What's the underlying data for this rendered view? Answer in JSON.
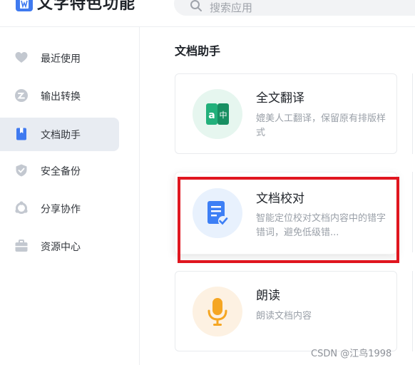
{
  "header": {
    "app_title": "文字特色功能",
    "search_placeholder": "搜索应用"
  },
  "sidebar": {
    "items": [
      {
        "label": "最近使用",
        "icon": "heart-icon",
        "active": false
      },
      {
        "label": "输出转换",
        "icon": "convert-icon",
        "active": false
      },
      {
        "label": "文档助手",
        "icon": "bookmark-icon",
        "active": true
      },
      {
        "label": "安全备份",
        "icon": "shield-icon",
        "active": false
      },
      {
        "label": "分享协作",
        "icon": "share-cycle-icon",
        "active": false
      },
      {
        "label": "资源中心",
        "icon": "briefcase-icon",
        "active": false
      }
    ]
  },
  "main": {
    "section_title": "文档助手",
    "cards": [
      {
        "title": "全文翻译",
        "desc": "媲美人工翻译，保留原有排版样式",
        "icon": "translate-icon",
        "icon_color": "#1fb07a",
        "circle_color": "#e6f6ef"
      },
      {
        "title": "文档校对",
        "desc": "智能定位校对文档内容中的错字错词，避免低级错...",
        "icon": "proofread-icon",
        "icon_color": "#3d7ff5",
        "circle_color": "#e8f1fd"
      },
      {
        "title": "朗读",
        "desc": "朗读文档内容",
        "icon": "microphone-icon",
        "icon_color": "#f5a623",
        "circle_color": "#fdf1e2"
      }
    ]
  },
  "watermark": "CSDN @江鸟1998",
  "colors": {
    "accent": "#3f7af0",
    "highlight_border": "#e0161f",
    "active_bg": "#e8ecf2"
  }
}
